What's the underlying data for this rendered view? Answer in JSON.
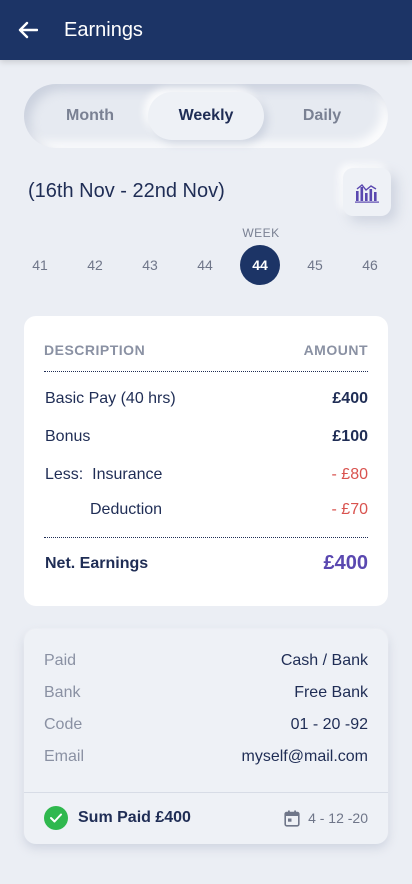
{
  "app_bar": {
    "title": "Earnings",
    "back_icon": "arrow-left-icon"
  },
  "tabs": [
    {
      "label": "Month",
      "active": false
    },
    {
      "label": "Weekly",
      "active": true
    },
    {
      "label": "Daily",
      "active": false
    }
  ],
  "date_range": "(16th Nov - 22nd Nov)",
  "chart_button_icon": "bar-chart-icon",
  "week_selector": {
    "caption": "WEEK",
    "weeks": [
      "41",
      "42",
      "43",
      "44",
      "44",
      "45",
      "46"
    ],
    "selected_index": 4
  },
  "breakdown": {
    "header": {
      "description": "DESCRIPTION",
      "amount": "AMOUNT"
    },
    "rows": [
      {
        "label": "Basic Pay (40 hrs)",
        "amount": "£400"
      },
      {
        "label": "Bonus",
        "amount": "£100"
      },
      {
        "label": "Less:  Insurance",
        "amount": "- £80"
      },
      {
        "label": "Deduction",
        "amount": "- £70"
      }
    ],
    "net": {
      "label": "Net. Earnings",
      "amount": "£400"
    }
  },
  "payment": {
    "rows": [
      {
        "key": "Paid",
        "value": "Cash / Bank"
      },
      {
        "key": "Bank",
        "value": "Free Bank"
      },
      {
        "key": "Code",
        "value": "01 - 20 -92"
      },
      {
        "key": "Email",
        "value": "myself@mail.com"
      }
    ],
    "sum_paid": "Sum Paid £400",
    "date": "4 - 12 -20"
  },
  "colors": {
    "primary": "#1c3466",
    "accent": "#5a48b0",
    "negative": "#d9534f",
    "success": "#2fb84e"
  }
}
